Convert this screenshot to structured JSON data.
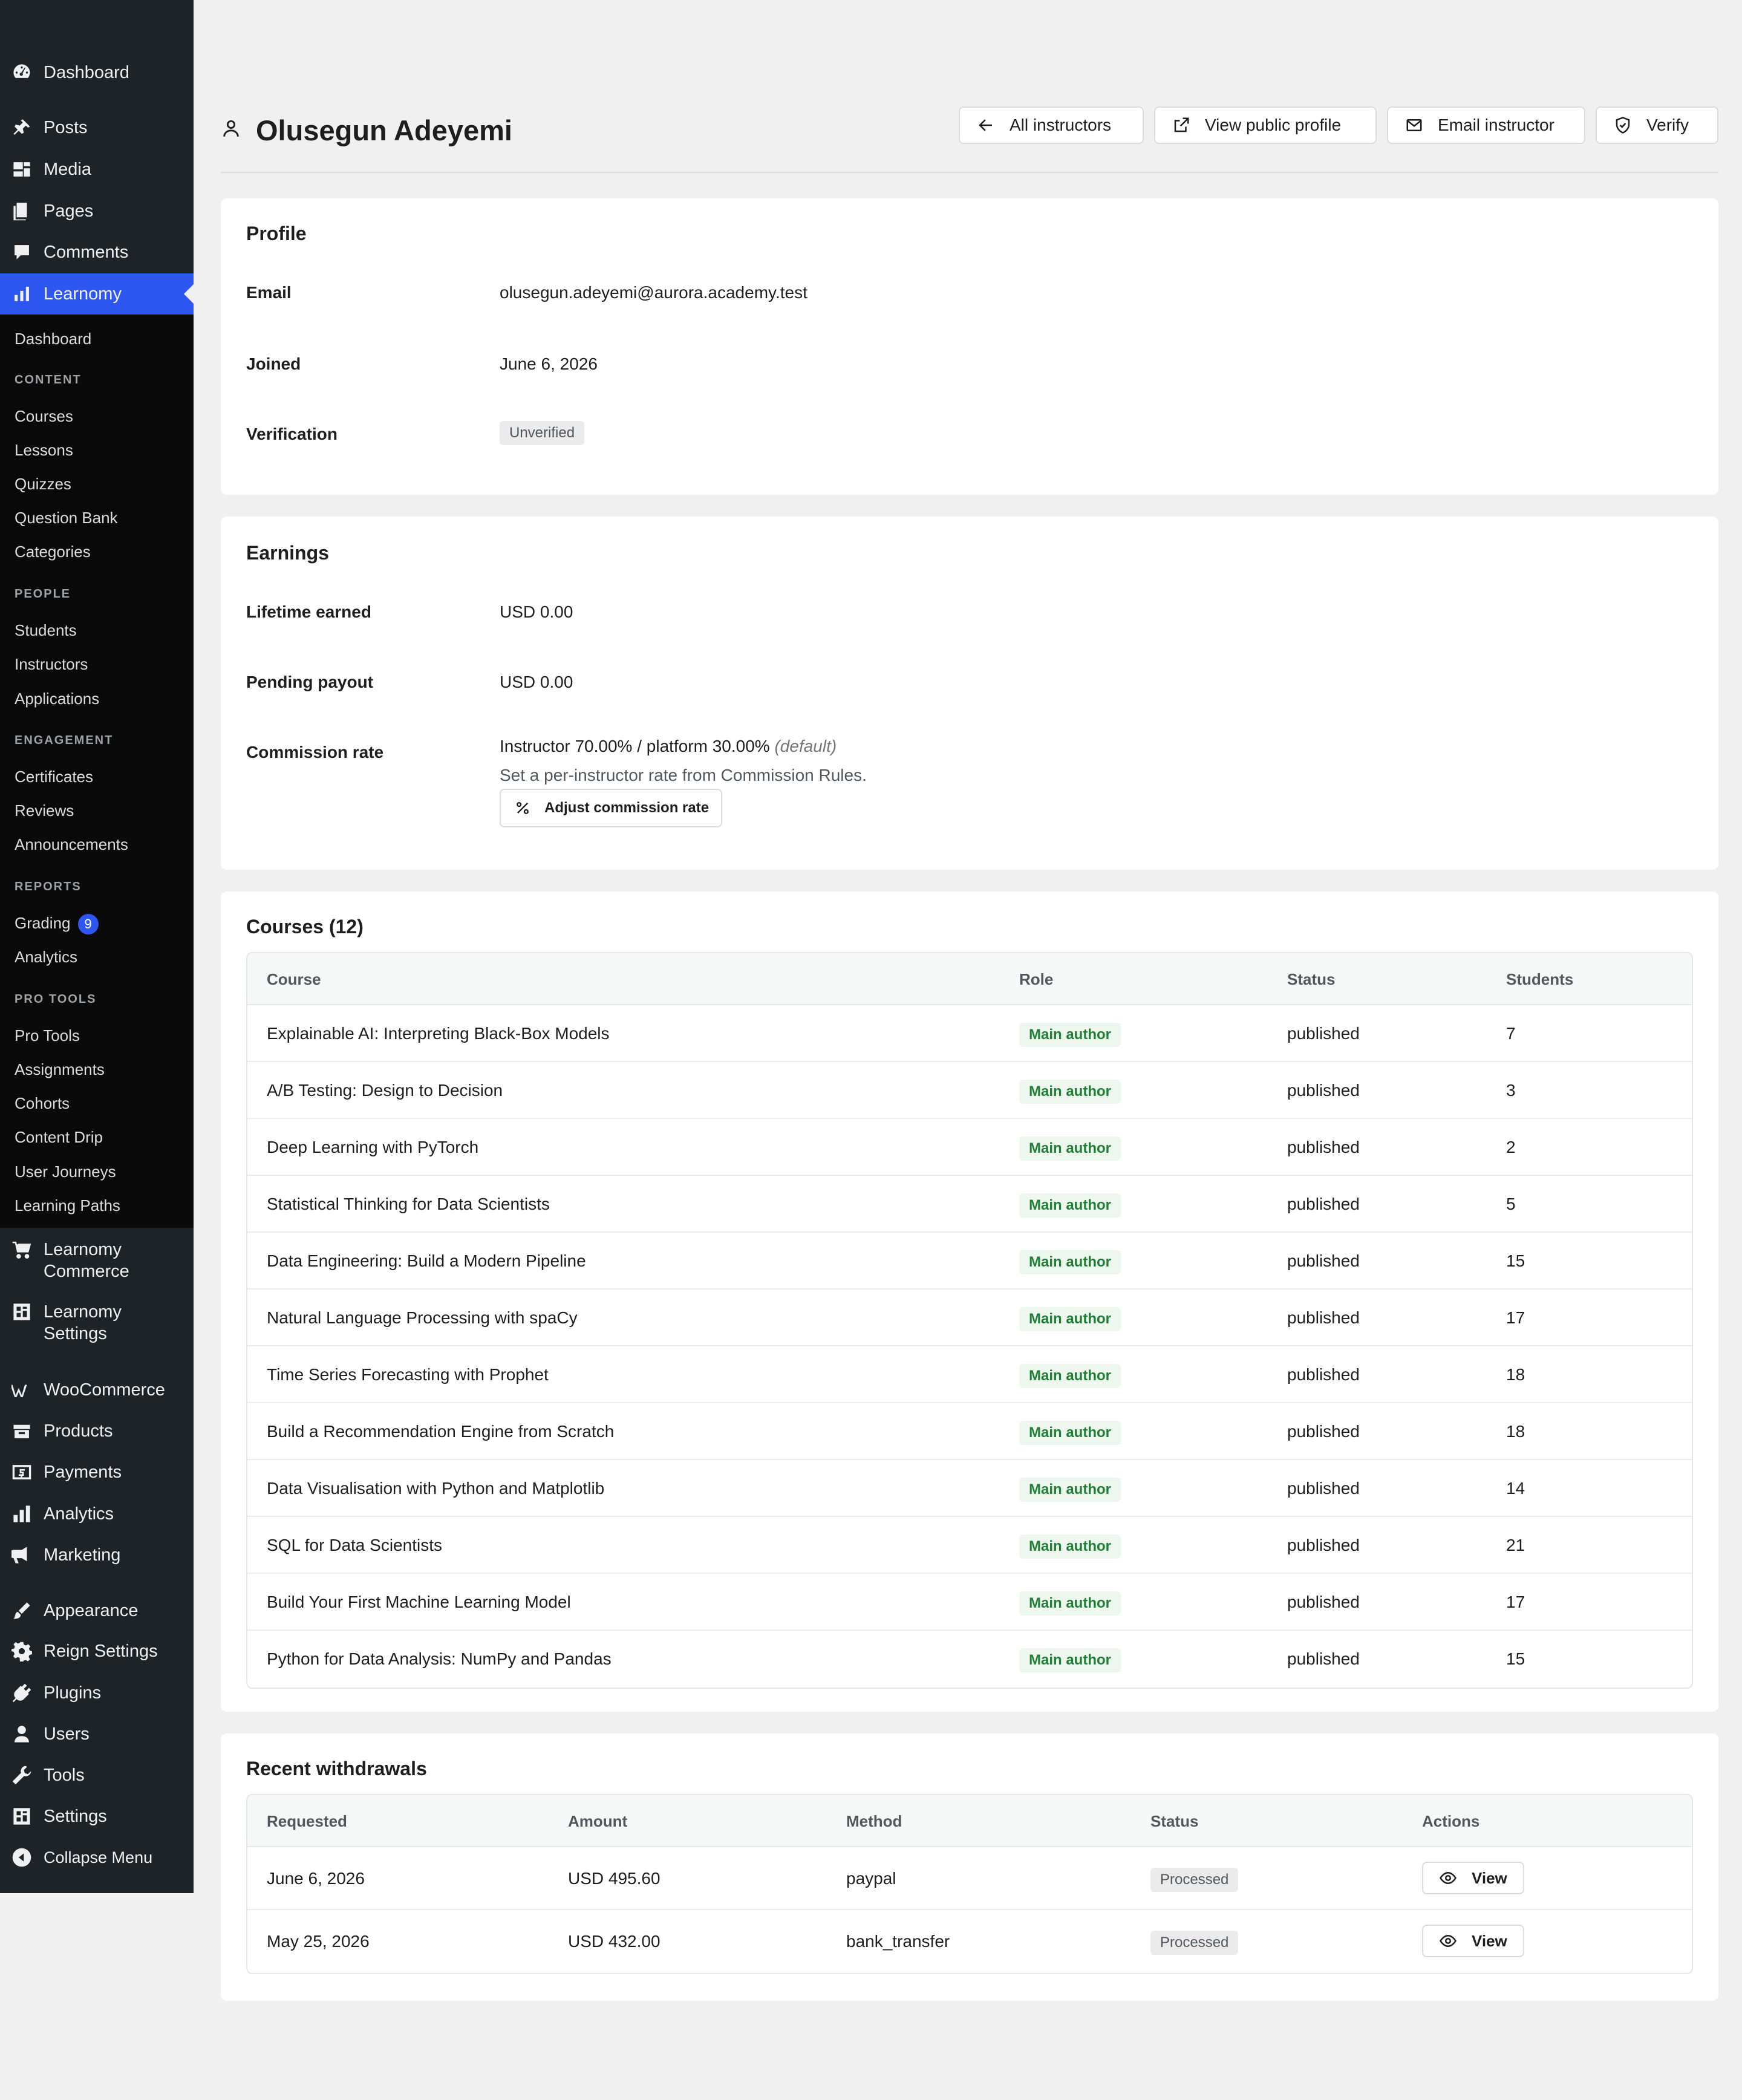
{
  "sidebar": {
    "top_items": [
      {
        "label": "Dashboard",
        "icon": "dashboard-icon"
      },
      {
        "label": "Posts",
        "icon": "pin-icon"
      },
      {
        "label": "Media",
        "icon": "media-icon"
      },
      {
        "label": "Pages",
        "icon": "pages-icon"
      },
      {
        "label": "Comments",
        "icon": "comments-icon"
      },
      {
        "label": "Learnomy",
        "icon": "chart-icon"
      }
    ],
    "submenu": {
      "dashboard": "Dashboard",
      "content_heading": "CONTENT",
      "content": [
        "Courses",
        "Lessons",
        "Quizzes",
        "Question Bank",
        "Categories"
      ],
      "people_heading": "PEOPLE",
      "people": [
        "Students",
        "Instructors",
        "Applications"
      ],
      "engagement_heading": "ENGAGEMENT",
      "engagement": [
        "Certificates",
        "Reviews",
        "Announcements"
      ],
      "reports_heading": "REPORTS",
      "grading": "Grading",
      "grading_count": "9",
      "analytics": "Analytics",
      "pro_heading": "PRO TOOLS",
      "pro": [
        "Pro Tools",
        "Assignments",
        "Cohorts",
        "Content Drip",
        "User Journeys",
        "Learning Paths"
      ]
    },
    "bottom_items": [
      {
        "label_line1": "Learnomy",
        "label_line2": "Commerce",
        "icon": "cart-icon"
      },
      {
        "label_line1": "Learnomy",
        "label_line2": "Settings",
        "icon": "settings-grid-icon"
      },
      {
        "label": "WooCommerce",
        "icon": "woo-icon"
      },
      {
        "label": "Products",
        "icon": "products-icon"
      },
      {
        "label": "Payments",
        "icon": "payments-icon"
      },
      {
        "label": "Analytics",
        "icon": "analytics-icon"
      },
      {
        "label": "Marketing",
        "icon": "megaphone-icon"
      },
      {
        "label": "Appearance",
        "icon": "brush-icon"
      },
      {
        "label": "Reign Settings",
        "icon": "gear-icon"
      },
      {
        "label": "Plugins",
        "icon": "plug-icon"
      },
      {
        "label": "Users",
        "icon": "user-icon"
      },
      {
        "label": "Tools",
        "icon": "wrench-icon"
      },
      {
        "label": "Settings",
        "icon": "settings-icon"
      },
      {
        "label": "Collapse Menu",
        "icon": "collapse-icon"
      }
    ]
  },
  "header": {
    "title": "Olusegun Adeyemi",
    "buttons": {
      "all_instructors": "All instructors",
      "view_public_profile": "View public profile",
      "email_instructor": "Email instructor",
      "verify": "Verify"
    }
  },
  "profile": {
    "title": "Profile",
    "email_label": "Email",
    "email": "olusegun.adeyemi@aurora.academy.test",
    "joined_label": "Joined",
    "joined": "June 6, 2026",
    "verification_label": "Verification",
    "verification": "Unverified"
  },
  "earnings": {
    "title": "Earnings",
    "lifetime_label": "Lifetime earned",
    "lifetime": "USD 0.00",
    "pending_label": "Pending payout",
    "pending": "USD 0.00",
    "commission_label": "Commission rate",
    "commission": "Instructor 70.00% / platform 30.00%",
    "commission_note": "(default)",
    "commission_hint": "Set a per-instructor rate from Commission Rules.",
    "adjust_button": "Adjust commission rate"
  },
  "courses": {
    "title": "Courses (12)",
    "columns": [
      "Course",
      "Role",
      "Status",
      "Students"
    ],
    "rows": [
      {
        "course": "Explainable AI: Interpreting Black-Box Models",
        "role": "Main author",
        "status": "published",
        "students": "7"
      },
      {
        "course": "A/B Testing: Design to Decision",
        "role": "Main author",
        "status": "published",
        "students": "3"
      },
      {
        "course": "Deep Learning with PyTorch",
        "role": "Main author",
        "status": "published",
        "students": "2"
      },
      {
        "course": "Statistical Thinking for Data Scientists",
        "role": "Main author",
        "status": "published",
        "students": "5"
      },
      {
        "course": "Data Engineering: Build a Modern Pipeline",
        "role": "Main author",
        "status": "published",
        "students": "15"
      },
      {
        "course": "Natural Language Processing with spaCy",
        "role": "Main author",
        "status": "published",
        "students": "17"
      },
      {
        "course": "Time Series Forecasting with Prophet",
        "role": "Main author",
        "status": "published",
        "students": "18"
      },
      {
        "course": "Build a Recommendation Engine from Scratch",
        "role": "Main author",
        "status": "published",
        "students": "18"
      },
      {
        "course": "Data Visualisation with Python and Matplotlib",
        "role": "Main author",
        "status": "published",
        "students": "14"
      },
      {
        "course": "SQL for Data Scientists",
        "role": "Main author",
        "status": "published",
        "students": "21"
      },
      {
        "course": "Build Your First Machine Learning Model",
        "role": "Main author",
        "status": "published",
        "students": "17"
      },
      {
        "course": "Python for Data Analysis: NumPy and Pandas",
        "role": "Main author",
        "status": "published",
        "students": "15"
      }
    ]
  },
  "withdrawals": {
    "title": "Recent withdrawals",
    "columns": [
      "Requested",
      "Amount",
      "Method",
      "Status",
      "Actions"
    ],
    "rows": [
      {
        "requested": "June 6, 2026",
        "amount": "USD 495.60",
        "method": "paypal",
        "status": "Processed",
        "action": "View"
      },
      {
        "requested": "May 25, 2026",
        "amount": "USD 432.00",
        "method": "bank_transfer",
        "status": "Processed",
        "action": "View"
      }
    ]
  },
  "colors": {
    "sidebar_bg": "#1d2327",
    "submenu_bg": "#0a0a0a",
    "accent": "#2d57f0",
    "role_badge_text": "#1e7e34",
    "role_badge_bg": "#edf7ee"
  }
}
